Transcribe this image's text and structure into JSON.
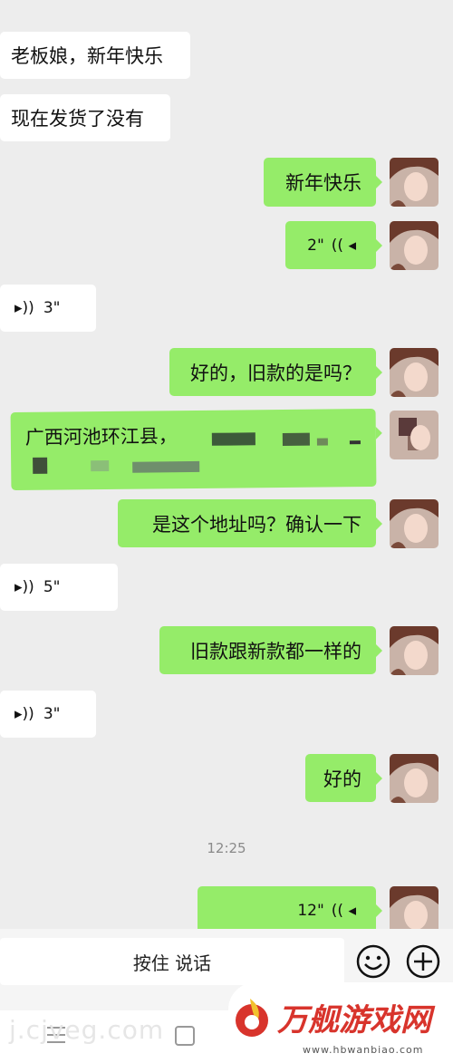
{
  "messages": {
    "m1": "老板娘，新年快乐",
    "m2": "现在发货了没有",
    "m3": "新年快乐",
    "m4": "2\"",
    "m5": "3\"",
    "m6": "好的，旧款的是吗？",
    "m7": "广西河池环江县，",
    "m8": "是这个地址吗？确认一下",
    "m9": "5\"",
    "m10": "旧款跟新款都一样的",
    "m11": "3\"",
    "m12": "好的",
    "timestamp": "12:25",
    "m13": "12\""
  },
  "input": {
    "talk_label": "按住 说话"
  },
  "watermark": {
    "left_text": "j.cjveg.com",
    "brand_name": "万舰游戏网",
    "brand_url": "www.hbwanbiao.com"
  },
  "colors": {
    "outgoing": "#95ec69",
    "incoming": "#ffffff",
    "background": "#ededed"
  }
}
